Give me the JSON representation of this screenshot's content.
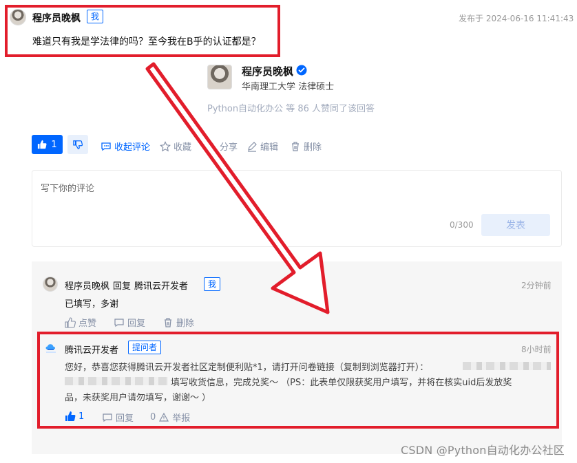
{
  "question": {
    "author": "程序员晚枫",
    "tag": "我",
    "published": "发布于 2024-06-16 11:41:43",
    "text": "难道只有我是学法律的吗？至今我在B乎的认证都是？"
  },
  "profile": {
    "name": "程序员晚枫",
    "verified_icon": "verified-badge-icon",
    "title": "华南理工大学 法律硕士",
    "approve_text": "Python自动化办公 等 86 人赞同了该回答"
  },
  "actions": {
    "upvote_count": "1",
    "collapse_comments": "收起评论",
    "favorite": "收藏",
    "share": "分享",
    "edit": "编辑",
    "delete": "删除"
  },
  "editor": {
    "placeholder": "写下你的评论",
    "count": "0/300",
    "submit": "发表"
  },
  "comments": [
    {
      "author": "程序员晚枫",
      "reply": "回复",
      "target": "腾讯云开发者",
      "tag": "我",
      "time": "2分钟前",
      "text": "已填写，多谢",
      "like": "点赞",
      "reply_btn": "回复",
      "delete": "删除"
    },
    {
      "author": "腾讯云开发者",
      "tag": "提问者",
      "time": "8小时前",
      "line1": "您好，恭喜您获得腾讯云开发者社区定制便利贴*1，请打开问卷链接（复制到浏览器打开）：",
      "line2": "填写收货信息，完成兑奖～ （PS：此表单仅限获奖用户填写，并将在核实uid后发放奖",
      "line3": "品，未获奖用户请勿填写，谢谢～ ）",
      "likes": "1",
      "reply_btn": "回复",
      "report_count": "0",
      "report": "举报"
    }
  ],
  "watermark": "CSDN @Python自动化办公社区",
  "colors": {
    "accent": "#0066ff",
    "annotation": "#e21d2b"
  }
}
